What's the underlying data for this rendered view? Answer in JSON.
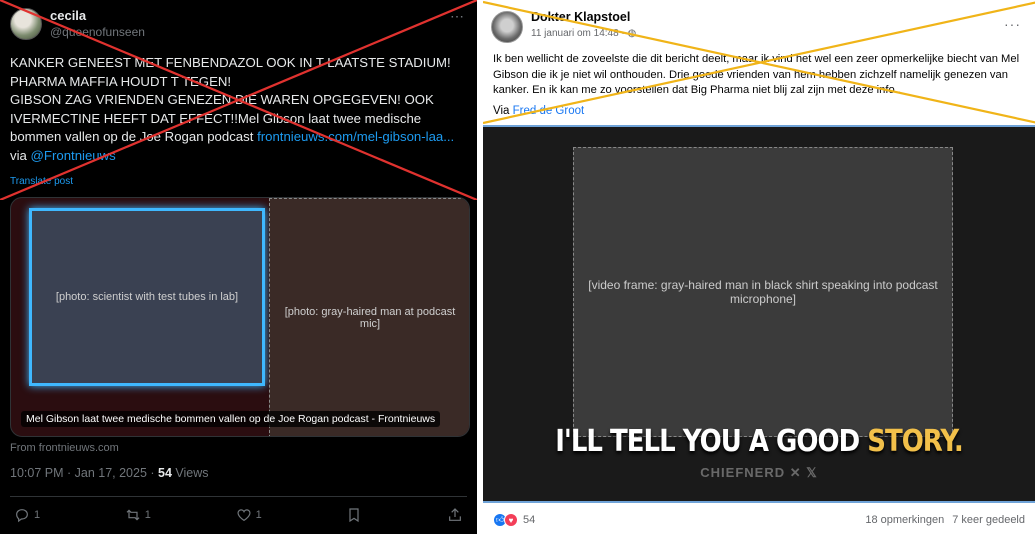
{
  "x_post": {
    "user_name": "cecila",
    "handle": "@queenofunseen",
    "more_icon": "⋯",
    "text_main": "KANKER GENEEST MET FENBENDAZOL OOK IN T LAATSTE STADIUM!\nPHARMA MAFFIA HOUDT T TEGEN!\nGIBSON ZAG VRIENDEN GENEZEN DIE WAREN OPGEGEVEN! OOK IVERMECTINE HEEFT DAT EFFECT!!Mel Gibson laat twee medische bommen vallen op de Joe Rogan podcast ",
    "text_link": "frontnieuws.com/mel-gibson-laa...",
    "text_via": " via ",
    "text_mention": "@Frontnieuws",
    "translate_label": "Translate post",
    "card_caption": "Mel Gibson laat twee medische bommen vallen op de Joe Rogan podcast - Frontnieuws",
    "card_from": "From frontnieuws.com",
    "timestamp": "10:07 PM · Jan 17, 2025 · ",
    "views_count": "54",
    "views_label": " Views",
    "replies": "1",
    "reposts": "1",
    "likes": "1",
    "cross_color": "#e0322f",
    "link_color": "#1d9bf0"
  },
  "fb_post": {
    "author": "Dokter Klapstoel",
    "date": "11 januari om 14:48 · ",
    "more_icon": "···",
    "body": "Ik ben wellicht de zoveelste die dit bericht deelt, maar ik vind het wel een zeer opmerkelijke biecht van Mel Gibson die ik je niet wil onthouden. Drie goede vrienden van hem hebben zichzelf namelijk genezen van kanker. En ik kan me zo voorstellen dat Big Pharma niet blij zal zijn met deze info..",
    "via_prefix": "Via ",
    "via_name": "Fred de Groot",
    "video_subtitle_white": "I'LL TELL YOU A GOOD ",
    "video_subtitle_yellow": "STORY.",
    "video_watermark": "CHIEFNERD ✕ 𝕏",
    "reactions_count": "54",
    "comments": "18 opmerkingen",
    "shares": "7 keer gedeeld",
    "cross_color": "#f0b418"
  }
}
